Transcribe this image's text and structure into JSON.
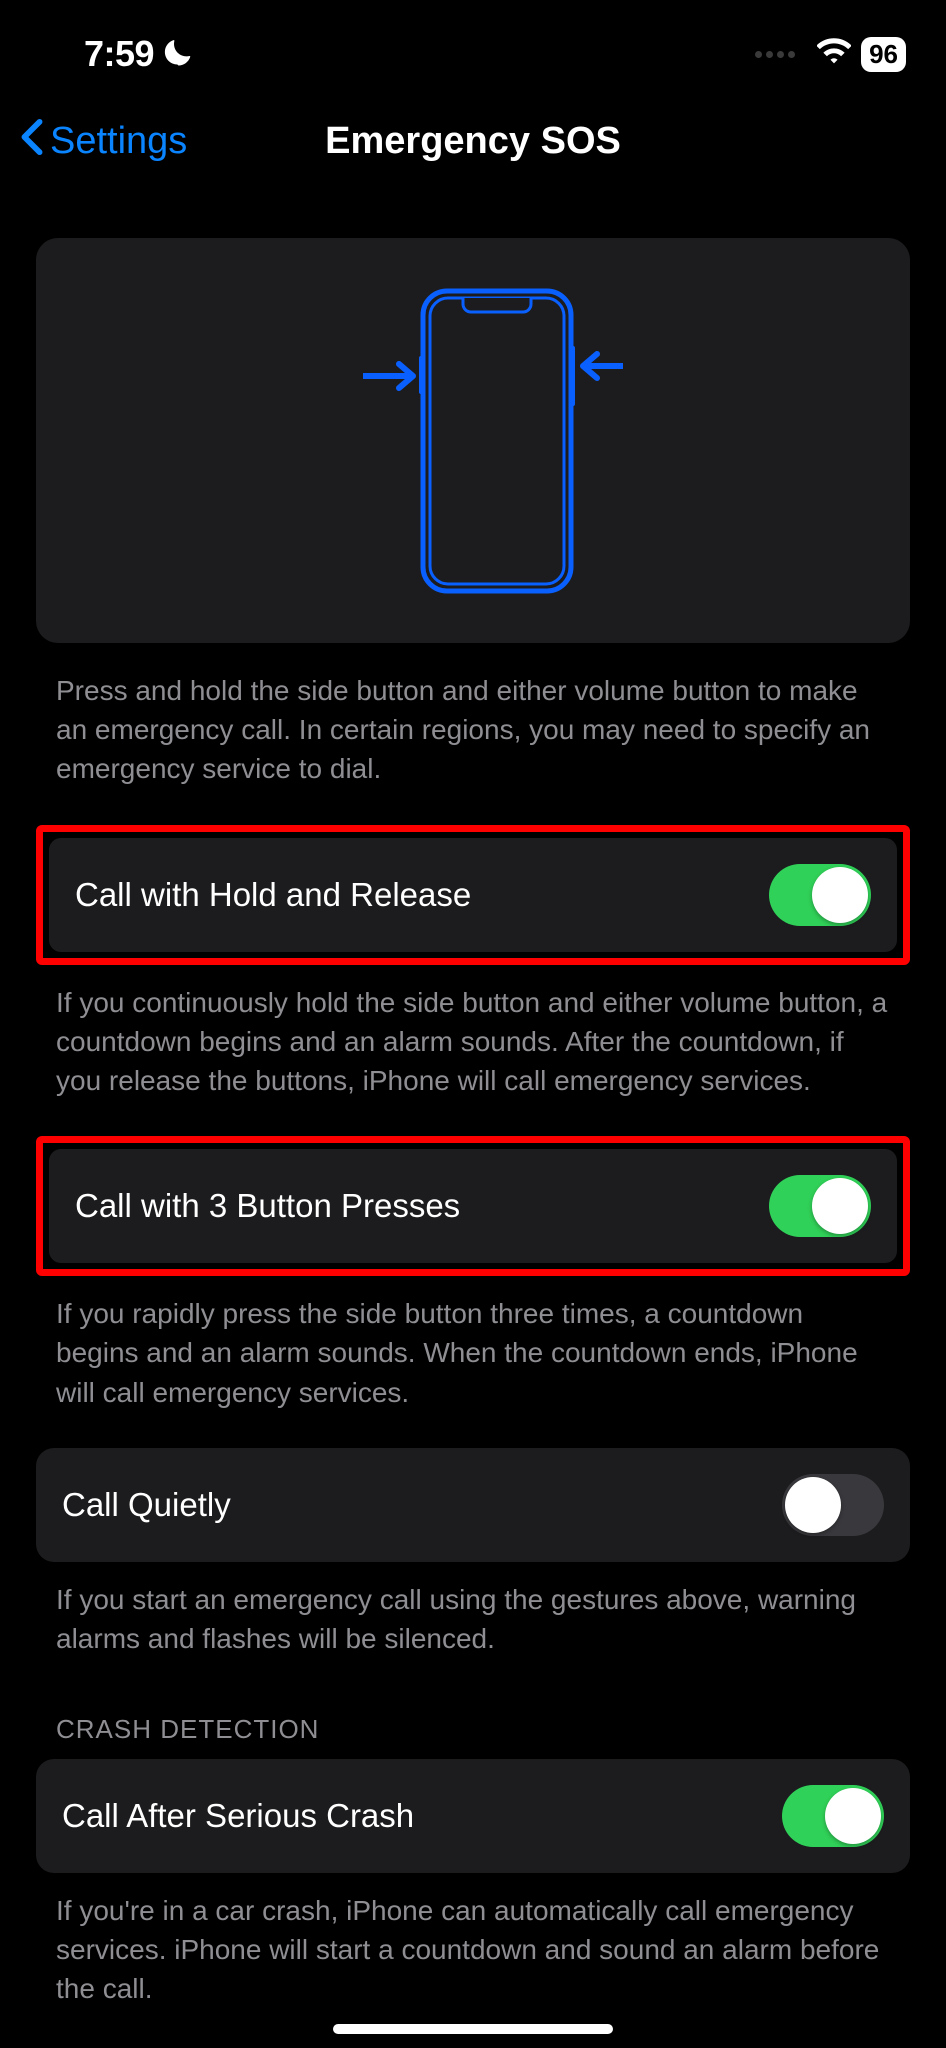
{
  "status": {
    "time": "7:59",
    "battery": "96"
  },
  "nav": {
    "back": "Settings",
    "title": "Emergency SOS"
  },
  "hero": {
    "description": "Press and hold the side button and either volume button to make an emergency call. In certain regions, you may need to specify an emergency service to dial."
  },
  "settings": {
    "holdRelease": {
      "label": "Call with Hold and Release",
      "on": true,
      "footer": "If you continuously hold the side button and either volume button, a countdown begins and an alarm sounds. After the countdown, if you release the buttons, iPhone will call emergency services."
    },
    "threePress": {
      "label": "Call with 3 Button Presses",
      "on": true,
      "footer": "If you rapidly press the side button three times, a countdown begins and an alarm sounds. When the countdown ends, iPhone will call emergency services."
    },
    "quietly": {
      "label": "Call Quietly",
      "on": false,
      "footer": "If you start an emergency call using the gestures above, warning alarms and flashes will be silenced."
    }
  },
  "crashDetection": {
    "header": "CRASH DETECTION",
    "afterCrash": {
      "label": "Call After Serious Crash",
      "on": true,
      "footer": "If you're in a car crash, iPhone can automatically call emergency services. iPhone will start a countdown and sound an alarm before the call."
    }
  }
}
